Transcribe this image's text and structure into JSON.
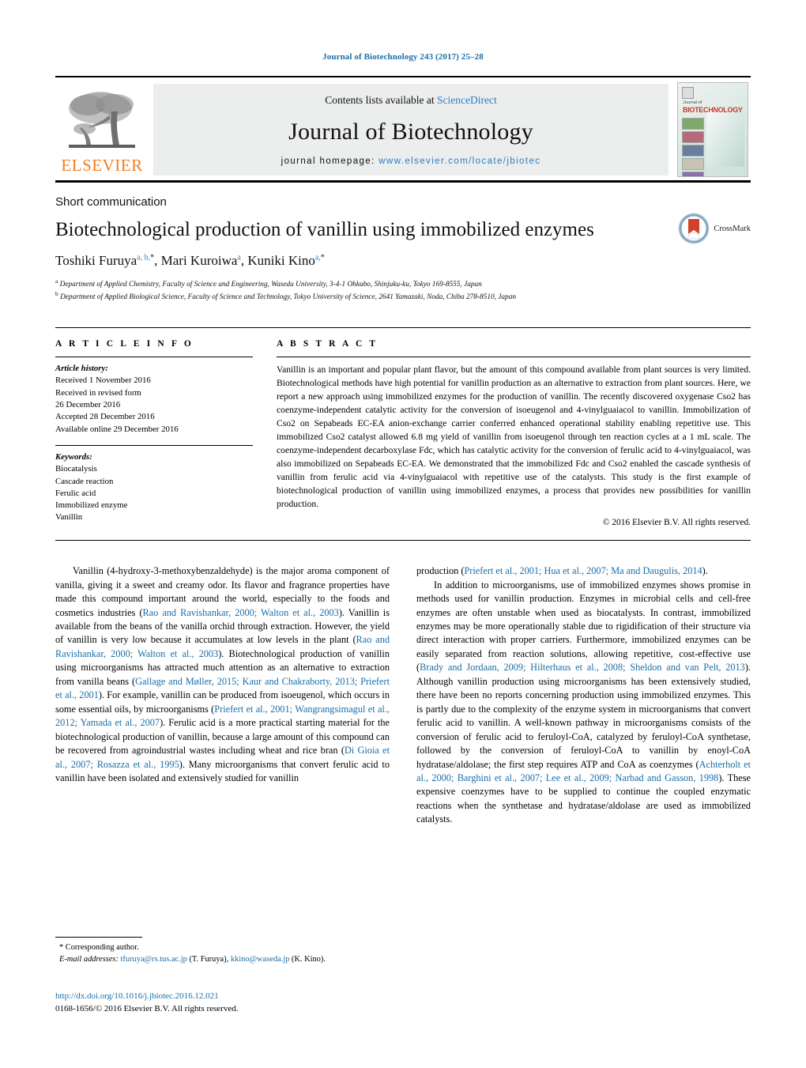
{
  "running_head": "Journal of Biotechnology 243 (2017) 25–28",
  "masthead": {
    "contents_prefix": "Contents lists available at ",
    "contents_link": "ScienceDirect",
    "journal_name": "Journal of Biotechnology",
    "homepage_prefix": "journal homepage: ",
    "homepage_url": "www.elsevier.com/locate/jbiotec",
    "publisher": "ELSEVIER",
    "cover": {
      "line1": "Journal of",
      "line2": "BIOTECHNOLOGY"
    }
  },
  "article": {
    "type": "Short communication",
    "title": "Biotechnological production of vanillin using immobilized enzymes",
    "authors_html": "Toshiki Furuya<sup>a, b,<span class=\"star\">*</span></sup>, Mari Kuroiwa<sup>a</sup>, Kuniki Kino<sup>a,<span class=\"star\">*</span></sup>",
    "affiliations": [
      "Department of Applied Chemistry, Faculty of Science and Engineering, Waseda University, 3-4-1 Ohkubo, Shinjuku-ku, Tokyo 169-8555, Japan",
      "Department of Applied Biological Science, Faculty of Science and Technology, Tokyo University of Science, 2641 Yamazaki, Noda, Chiba 278-8510, Japan"
    ],
    "affil_markers": [
      "a",
      "b"
    ],
    "crossmark_label": "CrossMark"
  },
  "article_info": {
    "heading": "A R T I C L E   I N F O",
    "history_label": "Article history:",
    "history": [
      "Received 1 November 2016",
      "Received in revised form",
      "26 December 2016",
      "Accepted 28 December 2016",
      "Available online 29 December 2016"
    ],
    "keywords_label": "Keywords:",
    "keywords": [
      "Biocatalysis",
      "Cascade reaction",
      "Ferulic acid",
      "Immobilized enzyme",
      "Vanillin"
    ]
  },
  "abstract": {
    "heading": "A B S T R A C T",
    "text": "Vanillin is an important and popular plant flavor, but the amount of this compound available from plant sources is very limited. Biotechnological methods have high potential for vanillin production as an alternative to extraction from plant sources. Here, we report a new approach using immobilized enzymes for the production of vanillin. The recently discovered oxygenase Cso2 has coenzyme-independent catalytic activity for the conversion of isoeugenol and 4-vinylguaiacol to vanillin. Immobilization of Cso2 on Sepabeads EC-EA anion-exchange carrier conferred enhanced operational stability enabling repetitive use. This immobilized Cso2 catalyst allowed 6.8 mg yield of vanillin from isoeugenol through ten reaction cycles at a 1 mL scale. The coenzyme-independent decarboxylase Fdc, which has catalytic activity for the conversion of ferulic acid to 4-vinylguaiacol, was also immobilized on Sepabeads EC-EA. We demonstrated that the immobilized Fdc and Cso2 enabled the cascade synthesis of vanillin from ferulic acid via 4-vinylguaiacol with repetitive use of the catalysts. This study is the first example of biotechnological production of vanillin using immobilized enzymes, a process that provides new possibilities for vanillin production.",
    "copyright": "© 2016 Elsevier B.V. All rights reserved."
  },
  "body": {
    "left": [
      {
        "indent": true,
        "parts": [
          {
            "t": "Vanillin (4-hydroxy-3-methoxybenzaldehyde) is the major aroma component of vanilla, giving it a sweet and creamy odor. Its flavor and fragrance properties have made this compound important around the world, especially to the foods and cosmetics industries ("
          },
          {
            "t": "Rao and Ravishankar, 2000; Walton et al., 2003",
            "ref": true
          },
          {
            "t": "). Vanillin is available from the beans of the vanilla orchid through extraction. However, the yield of vanillin is very low because it accumulates at low levels in the plant ("
          },
          {
            "t": "Rao and Ravishankar, 2000; Walton et al., 2003",
            "ref": true
          },
          {
            "t": "). Biotechnological production of vanillin using microorganisms has attracted much attention as an alternative to extraction from vanilla beans ("
          },
          {
            "t": "Gallage and Møller, 2015; Kaur and Chakraborty, 2013; Priefert et al., 2001",
            "ref": true
          },
          {
            "t": "). For example, vanillin can be produced from isoeugenol, which occurs in some essential oils, by microorganisms ("
          },
          {
            "t": "Priefert et al., 2001; Wangrangsimagul et al., 2012; Yamada et al., 2007",
            "ref": true
          },
          {
            "t": "). Ferulic acid is a more practical starting material for the biotechnological production of vanillin, because a large amount of this compound can be recovered from agroindustrial wastes including wheat and rice bran ("
          },
          {
            "t": "Di Gioia et al., 2007; Rosazza et al., 1995",
            "ref": true
          },
          {
            "t": "). Many microorganisms that convert ferulic acid to vanillin have been isolated and extensively studied for vanillin"
          }
        ]
      }
    ],
    "right": [
      {
        "indent": false,
        "parts": [
          {
            "t": "production ("
          },
          {
            "t": "Priefert et al., 2001; Hua et al., 2007; Ma and Daugulis, 2014",
            "ref": true
          },
          {
            "t": ")."
          }
        ]
      },
      {
        "indent": true,
        "parts": [
          {
            "t": "In addition to microorganisms, use of immobilized enzymes shows promise in methods used for vanillin production. Enzymes in microbial cells and cell-free enzymes are often unstable when used as biocatalysts. In contrast, immobilized enzymes may be more operationally stable due to rigidification of their structure via direct interaction with proper carriers. Furthermore, immobilized enzymes can be easily separated from reaction solutions, allowing repetitive, cost-effective use ("
          },
          {
            "t": "Brady and Jordaan, 2009; Hilterhaus et al., 2008; Sheldon and van Pelt, 2013",
            "ref": true
          },
          {
            "t": "). Although vanillin production using microorganisms has been extensively studied, there have been no reports concerning production using immobilized enzymes. This is partly due to the complexity of the enzyme system in microorganisms that convert ferulic acid to vanillin. A well-known pathway in microorganisms consists of the conversion of ferulic acid to feruloyl-CoA, catalyzed by feruloyl-CoA synthetase, followed by the conversion of feruloyl-CoA to vanillin by enoyl-CoA hydratase/aldolase; the first step requires ATP and CoA as coenzymes ("
          },
          {
            "t": "Achterholt et al., 2000; Barghini et al., 2007; Lee et al., 2009; Narbad and Gasson, 1998",
            "ref": true
          },
          {
            "t": "). These expensive coenzymes have to be supplied to continue the coupled enzymatic reactions when the synthetase and hydratase/aldolase are used as immobilized catalysts."
          }
        ]
      }
    ]
  },
  "footnote": {
    "corresponding": "* Corresponding author.",
    "email_label": "E-mail addresses:",
    "email1": "tfuruya@rs.tus.ac.jp",
    "email1_who": "(T. Furuya),",
    "email2": "kkino@waseda.jp",
    "email2_who": "(K. Kino)."
  },
  "doi": {
    "url": "http://dx.doi.org/10.1016/j.jbiotec.2016.12.021",
    "issn_line": "0168-1656/© 2016 Elsevier B.V. All rights reserved."
  },
  "colors": {
    "link": "#1a6ea8",
    "elsevier_orange": "#f47c20",
    "band_gray": "#eceded"
  }
}
